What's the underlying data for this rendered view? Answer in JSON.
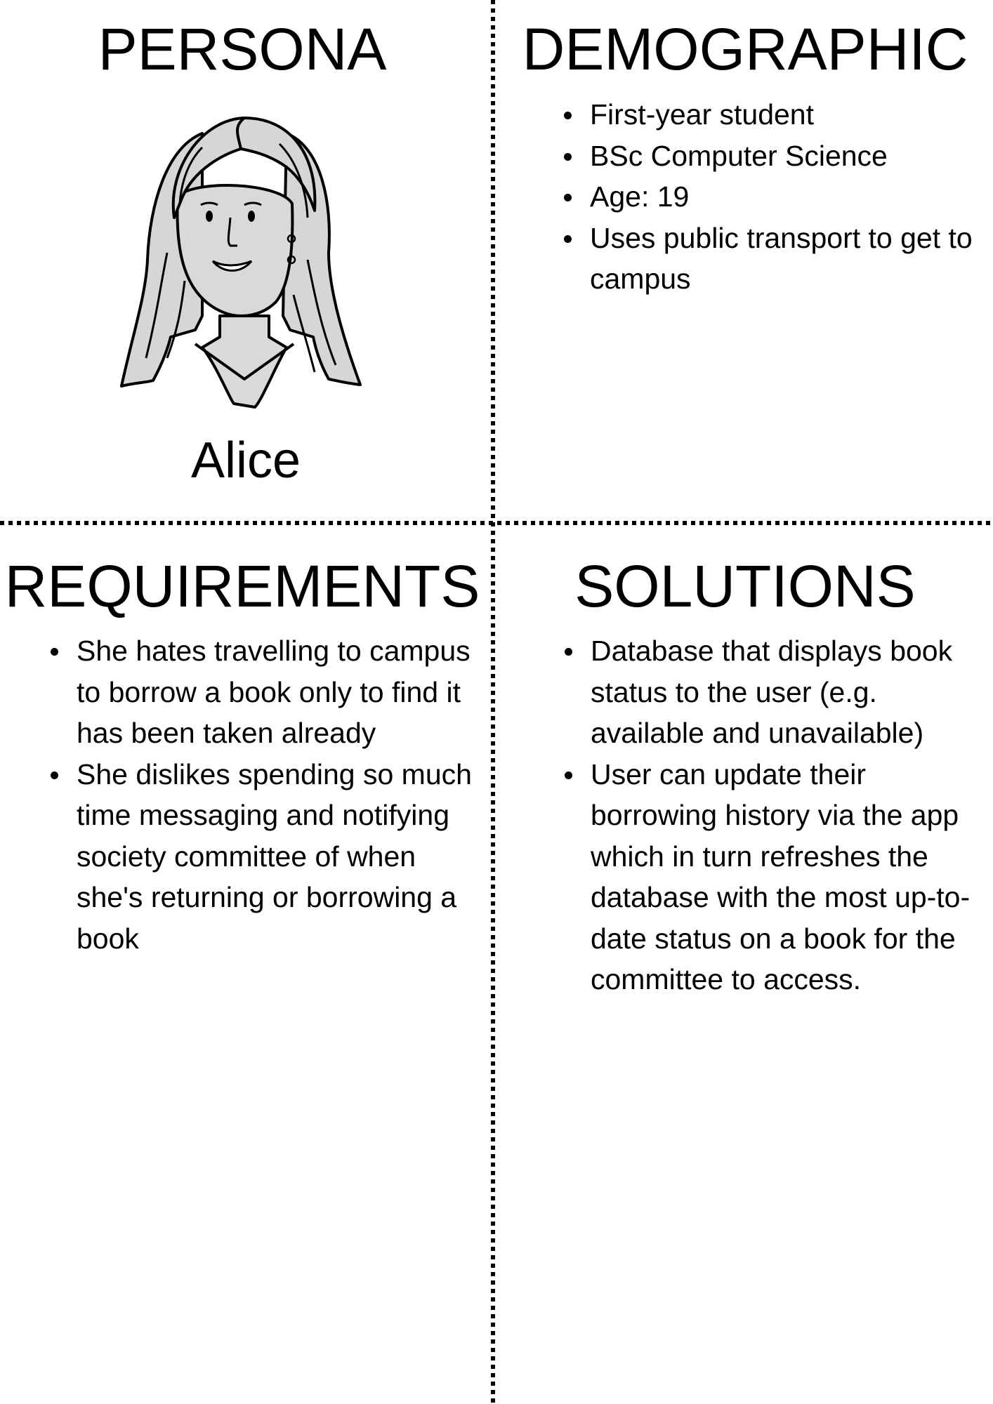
{
  "persona": {
    "heading": "PERSONA",
    "name": "Alice",
    "portrait_icon": "woman-portrait-icon"
  },
  "demographic": {
    "heading": "DEMOGRAPHIC",
    "items": [
      "First-year student",
      "BSc Computer Science",
      "Age: 19",
      "Uses public transport to get to campus"
    ]
  },
  "requirements": {
    "heading": "REQUIREMENTS",
    "items": [
      "She hates travelling to campus to borrow a book only to find it has been taken already",
      "She dislikes spending so much time messaging and notifying society committee of when she's returning or borrowing a book"
    ]
  },
  "solutions": {
    "heading": "SOLUTIONS",
    "items": [
      "Database that displays book status to the user (e.g. available and unavailable)",
      "User can update their borrowing history via the app which in turn refreshes the database with the most up-to-date status on a book for the committee to access."
    ]
  },
  "colors": {
    "ink": "#000000",
    "hair_fill": "#d6d6d6",
    "skin_fill": "#d9d9d9",
    "background": "#ffffff"
  }
}
